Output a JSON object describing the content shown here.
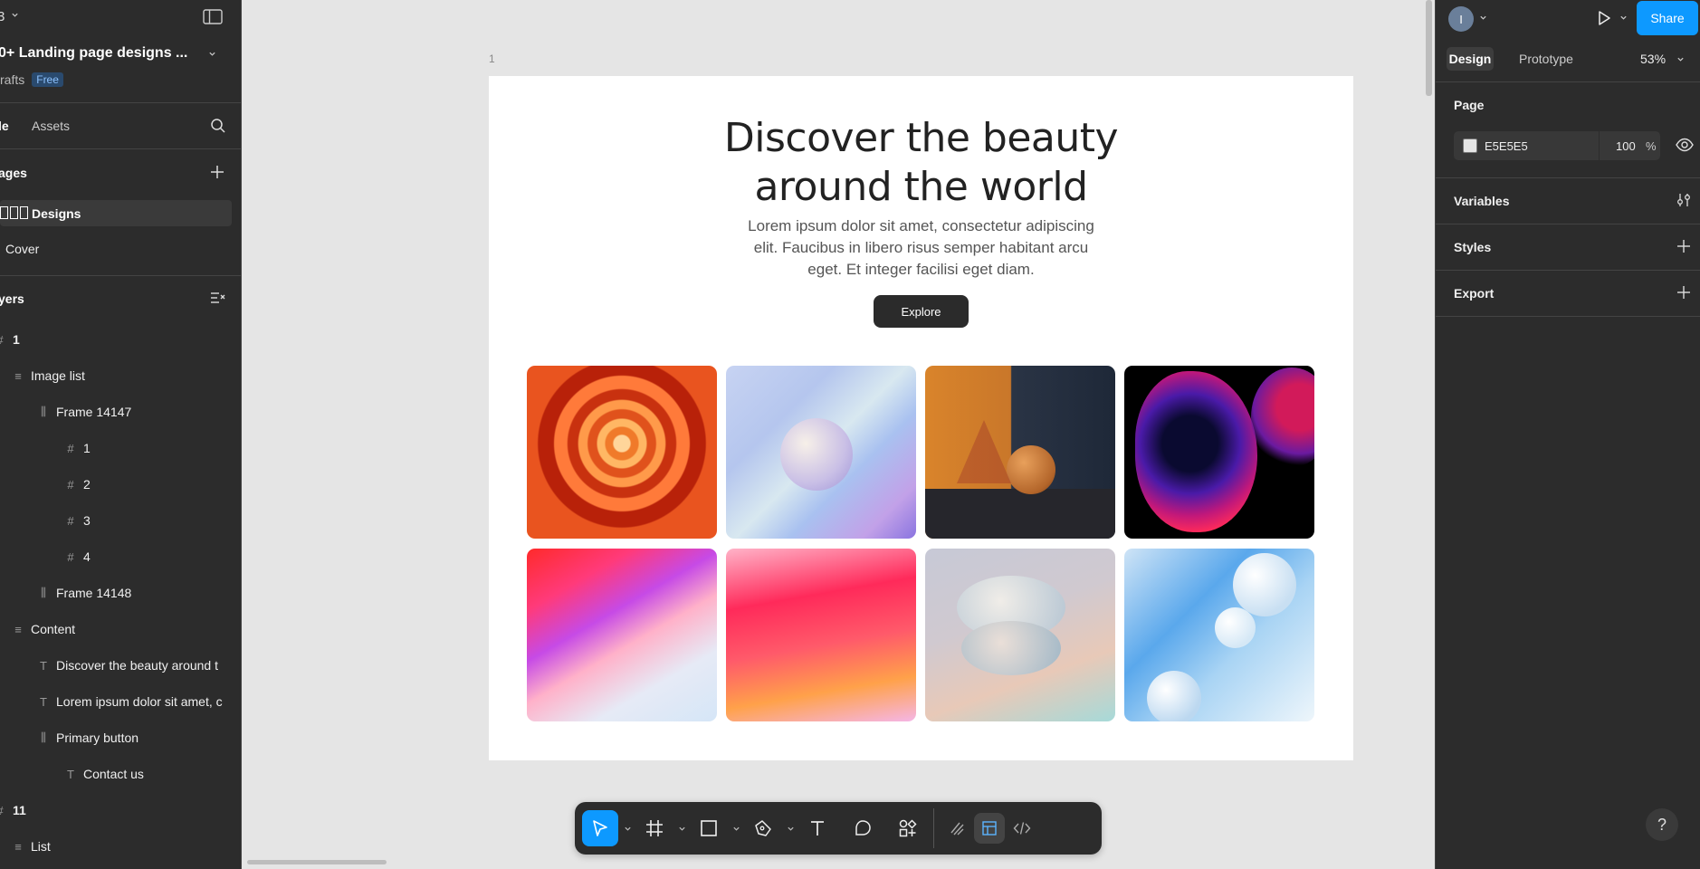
{
  "file": {
    "menu_fragment": "3",
    "name": "0+ Landing page designs ...",
    "location": "rafts",
    "plan_badge": "Free"
  },
  "left_tabs": {
    "file_tab": "le",
    "assets_tab": "Assets"
  },
  "pages": {
    "header": "ages",
    "items": [
      {
        "label": "Designs",
        "selected": true
      },
      {
        "label": "Cover",
        "selected": false
      }
    ]
  },
  "layers": {
    "header": "yers",
    "items": [
      {
        "label": "1",
        "kind": "frame",
        "depth": 0
      },
      {
        "label": "Image list",
        "kind": "autolayout-v",
        "depth": 1
      },
      {
        "label": "Frame 14147",
        "kind": "autolayout-h",
        "depth": 2
      },
      {
        "label": "1",
        "kind": "frame",
        "depth": 3
      },
      {
        "label": "2",
        "kind": "frame",
        "depth": 3
      },
      {
        "label": "3",
        "kind": "frame",
        "depth": 3
      },
      {
        "label": "4",
        "kind": "frame",
        "depth": 3
      },
      {
        "label": "Frame 14148",
        "kind": "autolayout-h",
        "depth": 2
      },
      {
        "label": "Content",
        "kind": "autolayout-v",
        "depth": 1
      },
      {
        "label": "Discover the beauty around t",
        "kind": "text",
        "depth": 2
      },
      {
        "label": "Lorem ipsum dolor sit amet, c",
        "kind": "text",
        "depth": 2
      },
      {
        "label": "Primary button",
        "kind": "autolayout-h",
        "depth": 2
      },
      {
        "label": "Contact us",
        "kind": "text",
        "depth": 3
      },
      {
        "label": "11",
        "kind": "frame",
        "depth": 0
      },
      {
        "label": "List",
        "kind": "autolayout-v",
        "depth": 1
      }
    ]
  },
  "canvas": {
    "frame_label": "1",
    "hero_title_line1": "Discover the beauty",
    "hero_title_line2": "around the world",
    "hero_body_line1": "Lorem ipsum dolor sit amet, consectetur adipiscing",
    "hero_body_line2": "elit. Faucibus in libero risus semper habitant arcu",
    "hero_body_line3": "eget. Et integer facilisi eget diam.",
    "cta_label": "Explore"
  },
  "toolbar": {
    "tools": [
      "move-tool",
      "frame-tool",
      "shape-tool",
      "pen-tool",
      "text-tool",
      "comment-tool",
      "actions-tool"
    ],
    "modes": [
      "draw-mode",
      "design-mode",
      "dev-mode"
    ],
    "active_tool": "move-tool",
    "active_mode": "design-mode"
  },
  "right": {
    "avatar_initial": "I",
    "share_label": "Share",
    "tab_design": "Design",
    "tab_prototype": "Prototype",
    "zoom": "53%",
    "page_section": "Page",
    "page_color": "E5E5E5",
    "page_opacity": "100",
    "percent_sign": "%",
    "variables_section": "Variables",
    "styles_section": "Styles",
    "export_section": "Export",
    "help_label": "?"
  },
  "colors": {
    "accent": "#0d99ff",
    "panel": "#2c2c2c",
    "canvas": "#e5e5e5"
  }
}
